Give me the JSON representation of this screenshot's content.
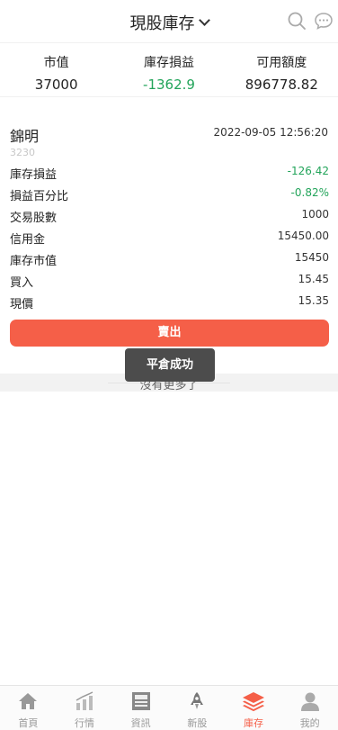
{
  "header": {
    "title": "現股庫存"
  },
  "summary": [
    {
      "label": "市值",
      "value": "37000",
      "color": "#222222"
    },
    {
      "label": "庫存損益",
      "value": "-1362.9",
      "color": "#22a45a"
    },
    {
      "label": "可用額度",
      "value": "896778.82",
      "color": "#222222"
    }
  ],
  "holding": {
    "name": "錦明",
    "code": "3230",
    "time": "2022-09-05 12:56:20",
    "rows": [
      {
        "label": "庫存損益",
        "value": "-126.42",
        "color": "#22a45a"
      },
      {
        "label": "損益百分比",
        "value": "-0.82%",
        "color": "#22a45a"
      },
      {
        "label": "交易股數",
        "value": "1000"
      },
      {
        "label": "信用金",
        "value": "15450.00"
      },
      {
        "label": "庫存市值",
        "value": "15450"
      },
      {
        "label": "買入",
        "value": "15.45"
      },
      {
        "label": "現價",
        "value": "15.35"
      }
    ],
    "sell_label": "賣出"
  },
  "no_more": "沒有更多了",
  "toast": "平倉成功",
  "tabs": [
    {
      "label": "首頁",
      "icon": "home-icon"
    },
    {
      "label": "行情",
      "icon": "chart-icon"
    },
    {
      "label": "資訊",
      "icon": "news-icon"
    },
    {
      "label": "新股",
      "icon": "rocket-icon"
    },
    {
      "label": "庫存",
      "icon": "layers-icon",
      "active": true
    },
    {
      "label": "我的",
      "icon": "user-icon"
    }
  ],
  "colors": {
    "accent": "#f55f48",
    "down": "#22a45a"
  }
}
